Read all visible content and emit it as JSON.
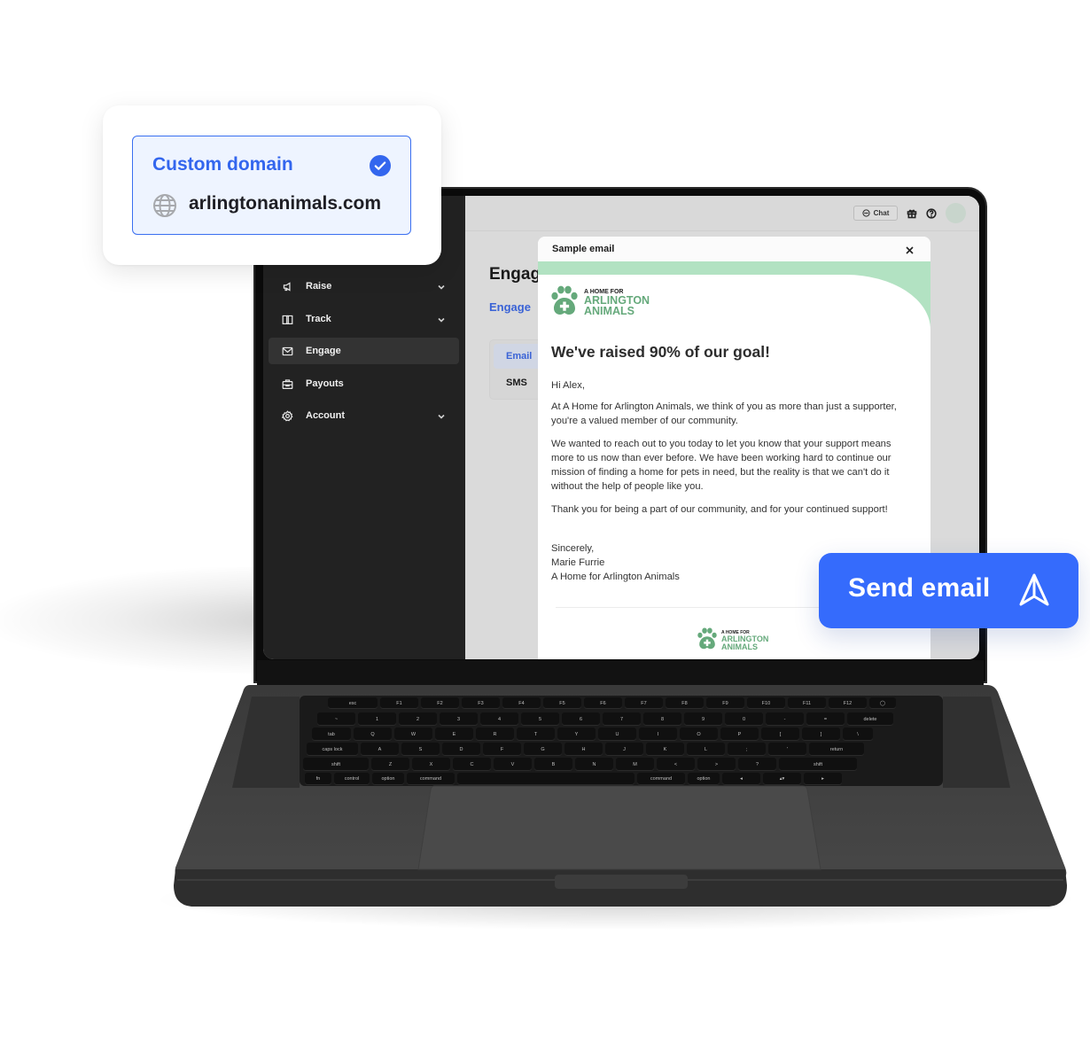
{
  "domain_card": {
    "title": "Custom domain",
    "value": "arlingtonanimals.com",
    "verified": true,
    "status_icon": "check-circle-icon",
    "value_icon": "globe-icon"
  },
  "sidebar": {
    "items": [
      {
        "label": "Raise",
        "icon": "megaphone-icon",
        "expandable": true,
        "active": false
      },
      {
        "label": "Track",
        "icon": "book-icon",
        "expandable": true,
        "active": false
      },
      {
        "label": "Engage",
        "icon": "mail-icon",
        "expandable": false,
        "active": true
      },
      {
        "label": "Payouts",
        "icon": "briefcase-icon",
        "expandable": false,
        "active": false
      },
      {
        "label": "Account",
        "icon": "gear-icon",
        "expandable": true,
        "active": false
      }
    ]
  },
  "topbar": {
    "chat_label": "Chat",
    "icons": [
      "chat-bubble-icon",
      "gift-icon",
      "help-icon",
      "avatar"
    ]
  },
  "page": {
    "title": "Engage",
    "subtab": "Engage",
    "channels": [
      {
        "label": "Email",
        "active": true
      },
      {
        "label": "SMS",
        "active": false
      }
    ]
  },
  "modal": {
    "title": "Sample email",
    "close_icon": "close-icon",
    "logo": {
      "line1": "A HOME FOR",
      "line2": "ARLINGTON",
      "line3": "ANIMALS"
    },
    "heading": "We've raised 90% of our goal!",
    "greeting": "Hi Alex,",
    "paragraphs": [
      "At A Home for Arlington Animals, we think of you as more than just a supporter, you're a valued member of our community.",
      "We wanted to reach out to you today to let you know that your support means more to us now than ever before. We have been working hard to continue our mission of finding a home for pets in need, but the reality is that we can't do it without the help of people like you.",
      "Thank you for being a part of our community, and for your continued support!"
    ],
    "signoff": "Sincerely,",
    "sender_name": "Marie Furrie",
    "sender_org": "A Home for Arlington Animals"
  },
  "send_button": {
    "label": "Send email",
    "icon": "send-arrow-icon"
  },
  "colors": {
    "brand_blue": "#356bfc",
    "link_blue": "#3a63d6",
    "logo_green": "#65a97b",
    "email_banner_green": "#b2e2c2",
    "sidebar_bg": "#222222"
  },
  "keyboard": {
    "rows": [
      [
        "esc",
        "F1",
        "F2",
        "F3",
        "F4",
        "F5",
        "F6",
        "F7",
        "F8",
        "F9",
        "F10",
        "F11",
        "F12",
        "power"
      ],
      [
        "~",
        "1",
        "2",
        "3",
        "4",
        "5",
        "6",
        "7",
        "8",
        "9",
        "0",
        "-",
        "=",
        "delete"
      ],
      [
        "tab",
        "Q",
        "W",
        "E",
        "R",
        "T",
        "Y",
        "U",
        "I",
        "O",
        "P",
        "[",
        "]",
        "\\"
      ],
      [
        "caps lock",
        "A",
        "S",
        "D",
        "F",
        "G",
        "H",
        "J",
        "K",
        "L",
        ";",
        "'",
        "return"
      ],
      [
        "shift",
        "Z",
        "X",
        "C",
        "V",
        "B",
        "N",
        "M",
        "<",
        ">",
        "?",
        "shift"
      ],
      [
        "fn",
        "control",
        "option",
        "command",
        "",
        "command",
        "option",
        "◂",
        "▴▾",
        "▸"
      ]
    ]
  }
}
